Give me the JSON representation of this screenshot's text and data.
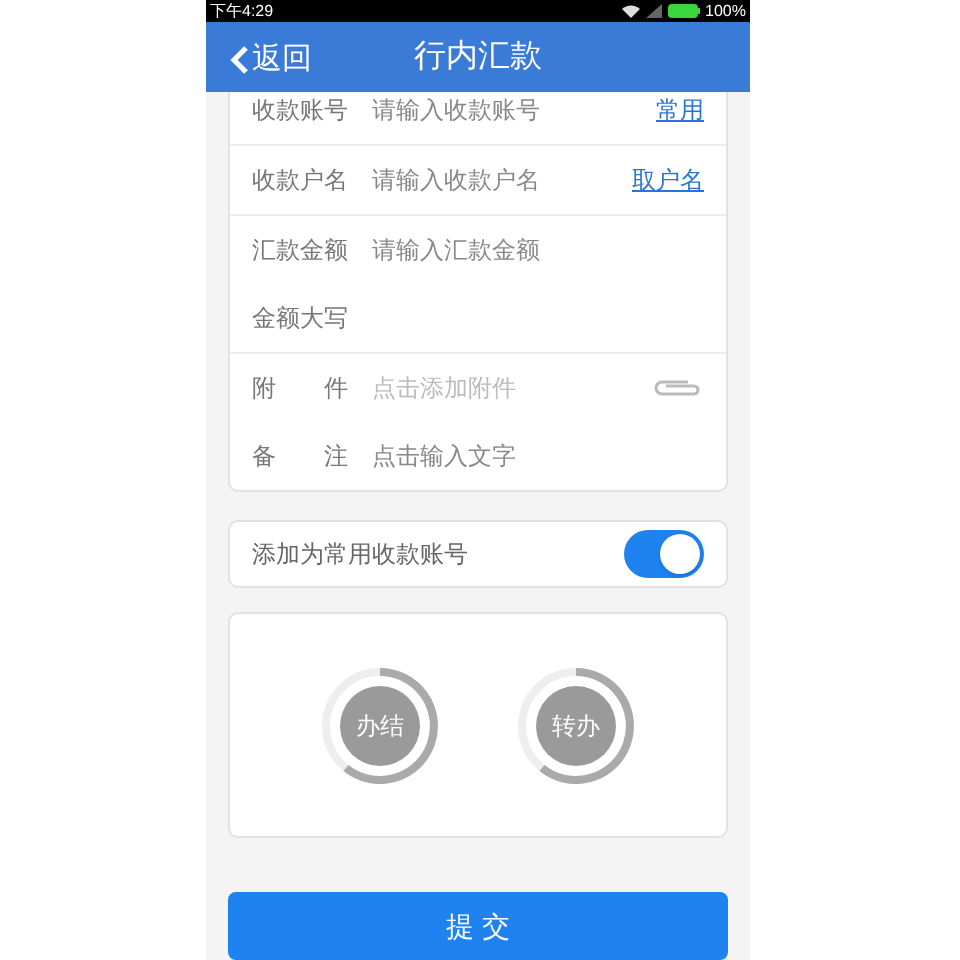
{
  "status_bar": {
    "time": "下午4:29",
    "battery": "100%"
  },
  "header": {
    "back": "返回",
    "title": "行内汇款"
  },
  "form_groups": [
    {
      "rows": [
        {
          "label": "收款账号",
          "placeholder": "请输入收款账号",
          "link": "常用"
        }
      ]
    },
    {
      "rows": [
        {
          "label": "收款户名",
          "placeholder": "请输入收款户名",
          "link": "取户名"
        }
      ]
    },
    {
      "rows": [
        {
          "label": "汇款金额",
          "placeholder": "请输入汇款金额"
        },
        {
          "label": "金额大写"
        }
      ]
    },
    {
      "rows": [
        {
          "label": "附　　件",
          "placeholder": "点击添加附件",
          "kind": "attachment"
        },
        {
          "label": "备　　注",
          "placeholder": "点击输入文字"
        }
      ]
    }
  ],
  "save_toggle": {
    "label": "添加为常用收款账号",
    "on": true
  },
  "actions": [
    "办结",
    "转办"
  ],
  "submit": "提 交"
}
